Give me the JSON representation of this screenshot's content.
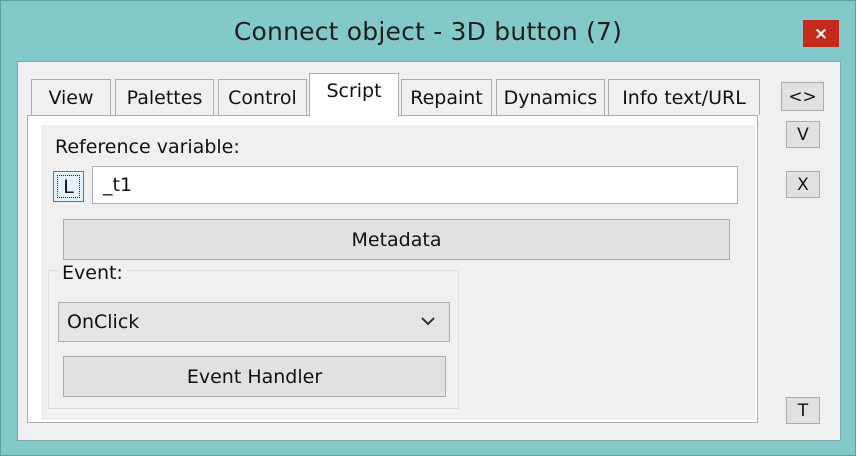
{
  "window": {
    "title": "Connect object - 3D button (7)",
    "close_label": "×"
  },
  "tabs": [
    {
      "label": "View",
      "active": false
    },
    {
      "label": "Palettes",
      "active": false
    },
    {
      "label": "Control",
      "active": false
    },
    {
      "label": "Script",
      "active": true
    },
    {
      "label": "Repaint",
      "active": false
    },
    {
      "label": "Dynamics",
      "active": false
    },
    {
      "label": "Info text/URL",
      "active": false
    }
  ],
  "script_tab": {
    "reference_label": "Reference variable:",
    "l_button_label": "L",
    "reference_value": "_t1",
    "metadata_label": "Metadata",
    "event_group_label": "Event:",
    "event_selected": "OnClick",
    "event_handler_label": "Event Handler"
  },
  "side_buttons": {
    "swap_label": "<>",
    "v_label": "V",
    "x_label": "X",
    "t_label": "T"
  },
  "colors": {
    "title_bar": "#83c9c9",
    "close_button": "#c42b1c",
    "dialog_background": "#f0f0f0"
  }
}
